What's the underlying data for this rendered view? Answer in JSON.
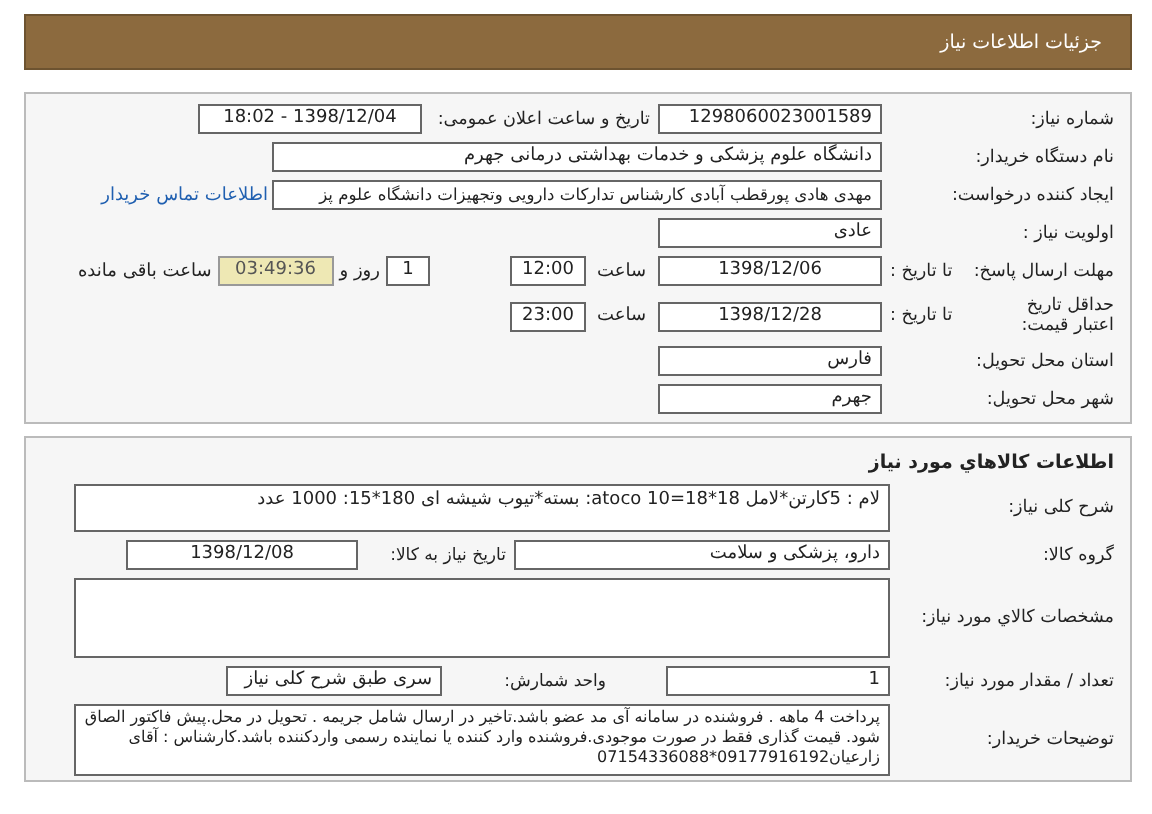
{
  "header": {
    "title": "جزئیات اطلاعات نیاز"
  },
  "need_info": {
    "need_number": {
      "label": "شماره نیاز:",
      "value": "1298060023001589"
    },
    "announce": {
      "label": "تاریخ و ساعت اعلان عمومی:",
      "value": "1398/12/04 - 18:02"
    },
    "buyer_org": {
      "label": "نام دستگاه خریدار:",
      "value": "دانشگاه علوم پزشکی و خدمات بهداشتی درمانی جهرم"
    },
    "requester": {
      "label": "ایجاد کننده درخواست:",
      "value": "مهدی هادی پورقطب آبادی کارشناس تدارکات دارویی وتجهیزات دانشگاه علوم پز",
      "contact_link": "اطلاعات تماس خریدار"
    },
    "priority": {
      "label": "اولویت نیاز :",
      "value": "عادی"
    },
    "reply_deadline": {
      "label": "مهلت ارسال پاسخ:",
      "to_date_label": "تا تاریخ :",
      "date": "1398/12/06",
      "time_label": "ساعت",
      "time": "12:00",
      "days": "1",
      "days_label": "روز و",
      "remaining": "03:49:36",
      "remaining_label": "ساعت باقی مانده"
    },
    "price_validity": {
      "label": "حداقل تاریخ اعتبار قیمت:",
      "to_date_label": "تا تاریخ :",
      "date": "1398/12/28",
      "time_label": "ساعت",
      "time": "23:00"
    },
    "province": {
      "label": "استان محل تحویل:",
      "value": "فارس"
    },
    "city": {
      "label": "شهر محل تحویل:",
      "value": "جهرم"
    }
  },
  "goods_info": {
    "title": "اطلاعات کالاهاي مورد نیاز",
    "summary": {
      "label": "شرح کلی نیاز:",
      "value": "لام : 5کارتن*لامل 18*18=10 atoco: بسته*تیوب  شیشه ای 180*15: 1000 عدد"
    },
    "group": {
      "label": "گروه کالا:",
      "value": "دارو، پزشکی و سلامت"
    },
    "need_date": {
      "label": "تاریخ نیاز به کالا:",
      "value": "1398/12/08"
    },
    "specs": {
      "label": "مشخصات کالاي مورد نیاز:"
    },
    "quantity": {
      "label": "تعداد / مقدار مورد نیاز:",
      "value": "1"
    },
    "unit": {
      "label": "واحد شمارش:",
      "value": "سری طبق شرح کلی نیاز"
    },
    "buyer_notes": {
      "label": "توضیحات خریدار:",
      "value": "پرداخت 4 ماهه . فروشنده در سامانه آی مد عضو باشد.تاخیر در ارسال شامل جریمه  . تحویل در محل.پیش فاکتور الصاق شود. قیمت گذاری فقط در صورت موجودی.فروشنده وارد کننده یا نماینده رسمی واردکننده باشد.کارشناس : آقای زارعیان09177916192*07154336088"
    }
  }
}
